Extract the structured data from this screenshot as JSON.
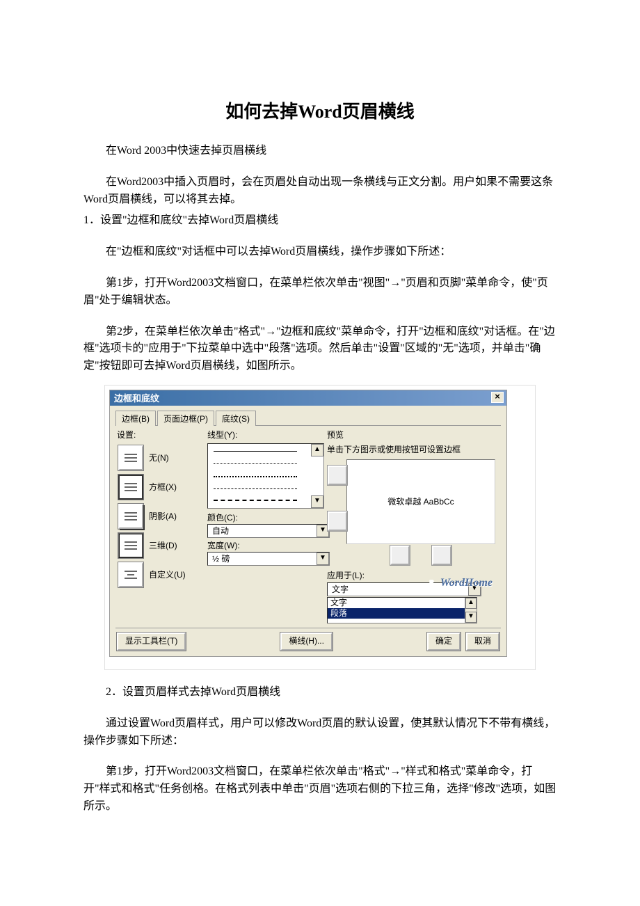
{
  "title": "如何去掉Word页眉横线",
  "p1": "在Word 2003中快速去掉页眉横线",
  "p2": "在Word2003中插入页眉时，会在页眉处自动出现一条横线与正文分割。用户如果不需要这条Word页眉横线，可以将其去掉。",
  "p3": "1．设置\"边框和底纹\"去掉Word页眉横线",
  "p4": "在\"边框和底纹\"对话框中可以去掉Word页眉横线，操作步骤如下所述：",
  "p5": "第1步，打开Word2003文档窗口，在菜单栏依次单击\"视图\"→\"页眉和页脚\"菜单命令，使\"页眉\"处于编辑状态。",
  "p6": "第2步，在菜单栏依次单击\"格式\"→\"边框和底纹\"菜单命令，打开\"边框和底纹\"对话框。在\"边框\"选项卡的\"应用于\"下拉菜单中选中\"段落\"选项。然后单击\"设置\"区域的\"无\"选项，并单击\"确定\"按钮即可去掉Word页眉横线，如图所示。",
  "p7": "2．设置页眉样式去掉Word页眉横线",
  "p8": "通过设置Word页眉样式，用户可以修改Word页眉的默认设置，使其默认情况下不带有横线，操作步骤如下所述：",
  "p9": "第1步，打开Word2003文档窗口，在菜单栏依次单击\"格式\"→\"样式和格式\"菜单命令，打开\"样式和格式\"任务创格。在格式列表中单击\"页眉\"选项右侧的下拉三角，选择\"修改\"选项，如图所示。",
  "dialog": {
    "title": "边框和底纹",
    "close": "×",
    "tabs": {
      "border": "边框(B)",
      "page": "页面边框(P)",
      "shading": "底纹(S)"
    },
    "setting": {
      "label": "设置:",
      "none": "无(N)",
      "box": "方框(X)",
      "shadow": "阴影(A)",
      "three_d": "三维(D)",
      "custom": "自定义(U)"
    },
    "line": {
      "label": "线型(Y):",
      "color_label": "颜色(C):",
      "color_value": "自动",
      "width_label": "宽度(W):",
      "width_value": "½ 磅"
    },
    "preview": {
      "label": "预览",
      "hint": "单击下方图示或使用按钮可设置边框",
      "sample": "微软卓越 AaBbCc"
    },
    "apply": {
      "label": "应用于(L):",
      "selected": "文字",
      "opt_text": "文字",
      "opt_para": "段落"
    },
    "footer": {
      "toolbar": "显示工具栏(T)",
      "horiz": "横线(H)...",
      "ok": "确定",
      "cancel": "取消"
    },
    "watermark": "WordHome"
  }
}
